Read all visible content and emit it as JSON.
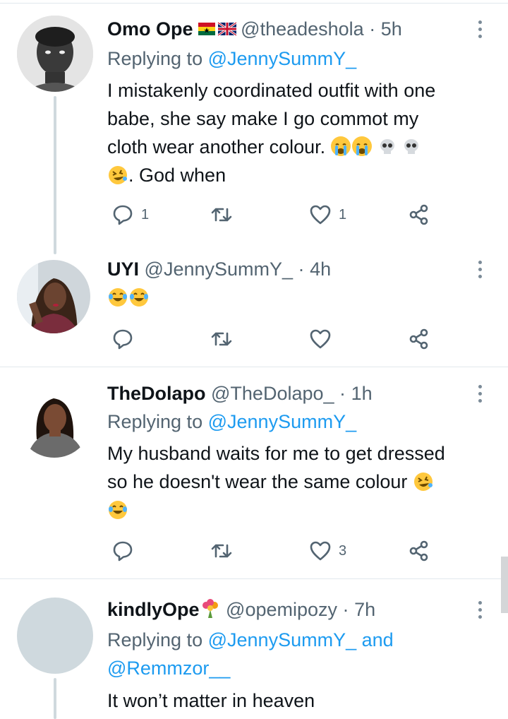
{
  "tweets": [
    {
      "name": "Omo Ope",
      "flags": "🇬🇭🇬🇧",
      "handle": "@theadeshola",
      "separator": "·",
      "time": "5h",
      "replying_prefix": "Replying to",
      "replying_to": "@JennySummY_",
      "text_line1": "I mistakenly coordinated outfit with one",
      "text_line2": "babe, she say make I go commot my",
      "text_line3": "cloth wear another colour.",
      "text_line4": ". God when",
      "reply_count": "1",
      "retweet_count": "",
      "like_count": "1"
    },
    {
      "name": "UYI",
      "handle": "@JennySummY_",
      "separator": "·",
      "time": "4h",
      "reply_count": "",
      "retweet_count": "",
      "like_count": ""
    },
    {
      "name": "TheDolapo",
      "handle": "@TheDolapo_",
      "separator": "·",
      "time": "1h",
      "replying_prefix": "Replying to",
      "replying_to": "@JennySummY_",
      "text_line1": "My husband waits for me to get dressed",
      "text_line2": "so he doesn't wear the same colour",
      "reply_count": "",
      "retweet_count": "",
      "like_count": "3"
    },
    {
      "name": "kindlyOpe",
      "name_emoji": "💐",
      "handle": "@opemipozy",
      "separator": "·",
      "time": "7h",
      "replying_prefix": "Replying to",
      "replying_to": "@JennySummY_",
      "replying_and": "and",
      "replying_to_2": "@Remmzor__",
      "text_line1": "It won’t matter in heaven"
    }
  ],
  "icons": {
    "reply": "reply-icon",
    "retweet": "retweet-icon",
    "like": "like-icon",
    "share": "share-icon",
    "more": "more-icon"
  },
  "colors": {
    "link": "#1d9bf0",
    "secondary_text": "#536471",
    "thread_line": "#cfd9de"
  }
}
